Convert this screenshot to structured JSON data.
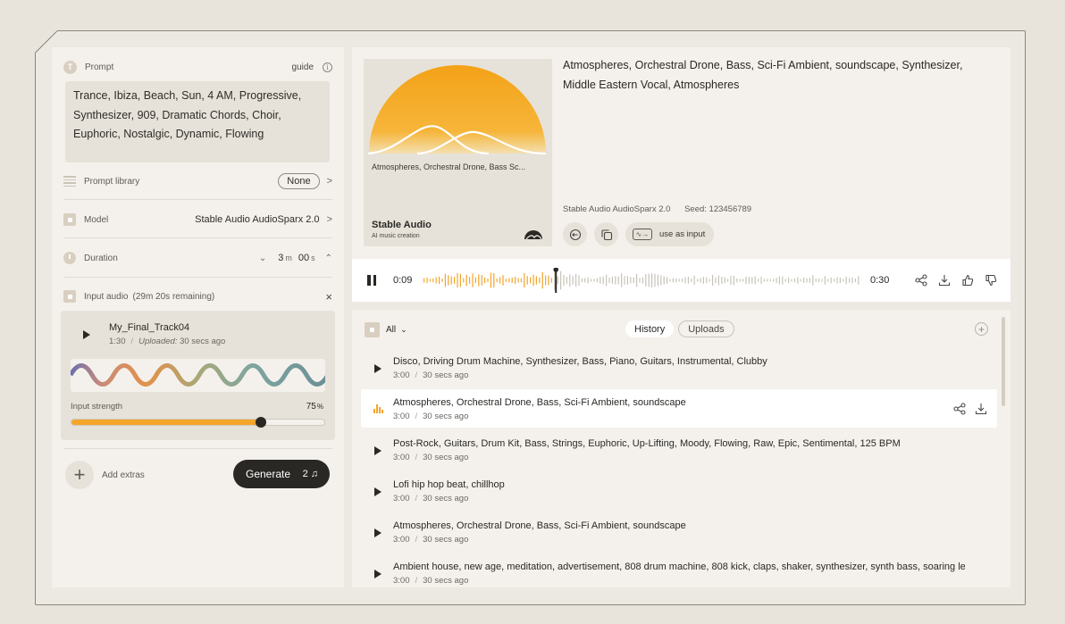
{
  "prompt": {
    "label": "Prompt",
    "guide": "guide",
    "text": "Trance, Ibiza, Beach, Sun, 4 AM, Progressive, Synthesizer, 909, Dramatic Chords, Choir, Euphoric, Nostalgic, Dynamic, Flowing"
  },
  "prompt_library": {
    "label": "Prompt library",
    "value": "None"
  },
  "model": {
    "label": "Model",
    "value": "Stable Audio AudioSparx 2.0"
  },
  "duration": {
    "label": "Duration",
    "minutes": "3",
    "minutes_unit": "m",
    "seconds": "00",
    "seconds_unit": "s"
  },
  "input_audio": {
    "label": "Input audio",
    "remaining": "(29m 20s remaining)",
    "file_name": "My_Final_Track04",
    "length": "1:30",
    "uploaded_label": "Uploaded:",
    "uploaded_time": "30 secs ago",
    "strength_label": "Input strength",
    "strength_value": "75",
    "strength_unit": "%",
    "strength_fraction": 0.75
  },
  "extras": {
    "label": "Add extras"
  },
  "generate": {
    "label": "Generate",
    "count": "2"
  },
  "track": {
    "cover_title": "Atmospheres, Orchestral Drone, Bass Sc...",
    "cover_brand": "Stable Audio",
    "cover_sub": "AI music creation",
    "title": "Atmospheres, Orchestral Drone, Bass, Sci-Fi Ambient, soundscape, Synthesizer, Middle Eastern Vocal, Atmospheres",
    "model": "Stable Audio AudioSparx 2.0",
    "seed": "Seed: 123456789",
    "use_input": "use as input"
  },
  "player": {
    "current": "0:09",
    "total": "0:30",
    "progress_fraction": 0.3
  },
  "history": {
    "filter": "All",
    "tabs": [
      "History",
      "Uploads"
    ],
    "active_tab": 0,
    "items": [
      {
        "title": "Disco, Driving Drum Machine, Synthesizer, Bass, Piano, Guitars, Instrumental, Clubby",
        "length": "3:00",
        "time": "30 secs ago"
      },
      {
        "title": "Atmospheres, Orchestral Drone, Bass, Sci-Fi Ambient, soundscape",
        "length": "3:00",
        "time": "30 secs ago"
      },
      {
        "title": "Post-Rock, Guitars, Drum Kit, Bass, Strings, Euphoric, Up-Lifting, Moody, Flowing, Raw, Epic, Sentimental, 125 BPM",
        "length": "3:00",
        "time": "30 secs ago"
      },
      {
        "title": "Lofi hip hop beat, chillhop",
        "length": "3:00",
        "time": "30 secs ago"
      },
      {
        "title": "Atmospheres, Orchestral Drone, Bass, Sci-Fi Ambient, soundscape",
        "length": "3:00",
        "time": "30 secs ago"
      },
      {
        "title": "Ambient house, new age, meditation, advertisement, 808 drum machine, 808 kick, claps, shaker, synthesizer, synth bass, soaring lea...",
        "length": "3:00",
        "time": "30 secs ago"
      }
    ]
  },
  "colors": {
    "accent": "#f4a52a",
    "dark": "#2a2825",
    "panel": "#f4f1ec",
    "field": "#e6e2d9"
  }
}
